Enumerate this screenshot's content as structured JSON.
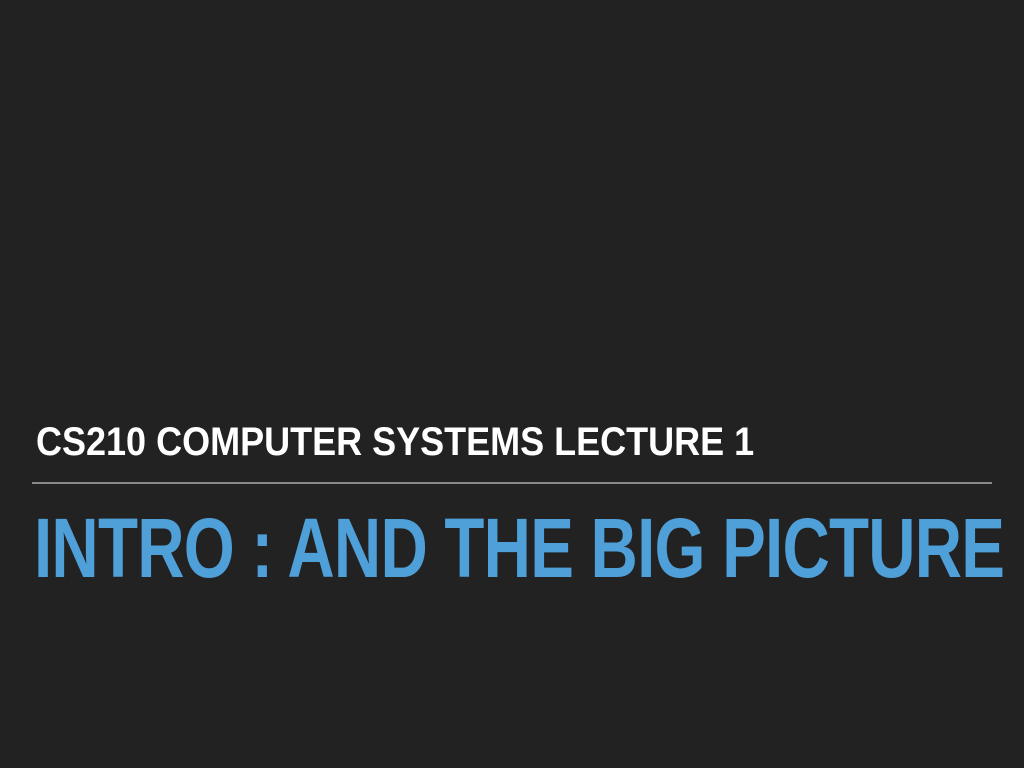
{
  "slide": {
    "subtitle": "CS210 COMPUTER SYSTEMS LECTURE 1",
    "title": "INTRO : AND THE BIG PICTURE"
  },
  "colors": {
    "background": "#222222",
    "subtitle_text": "#ffffff",
    "title_text": "#4f9fd8",
    "divider": "#8a8a8a"
  }
}
